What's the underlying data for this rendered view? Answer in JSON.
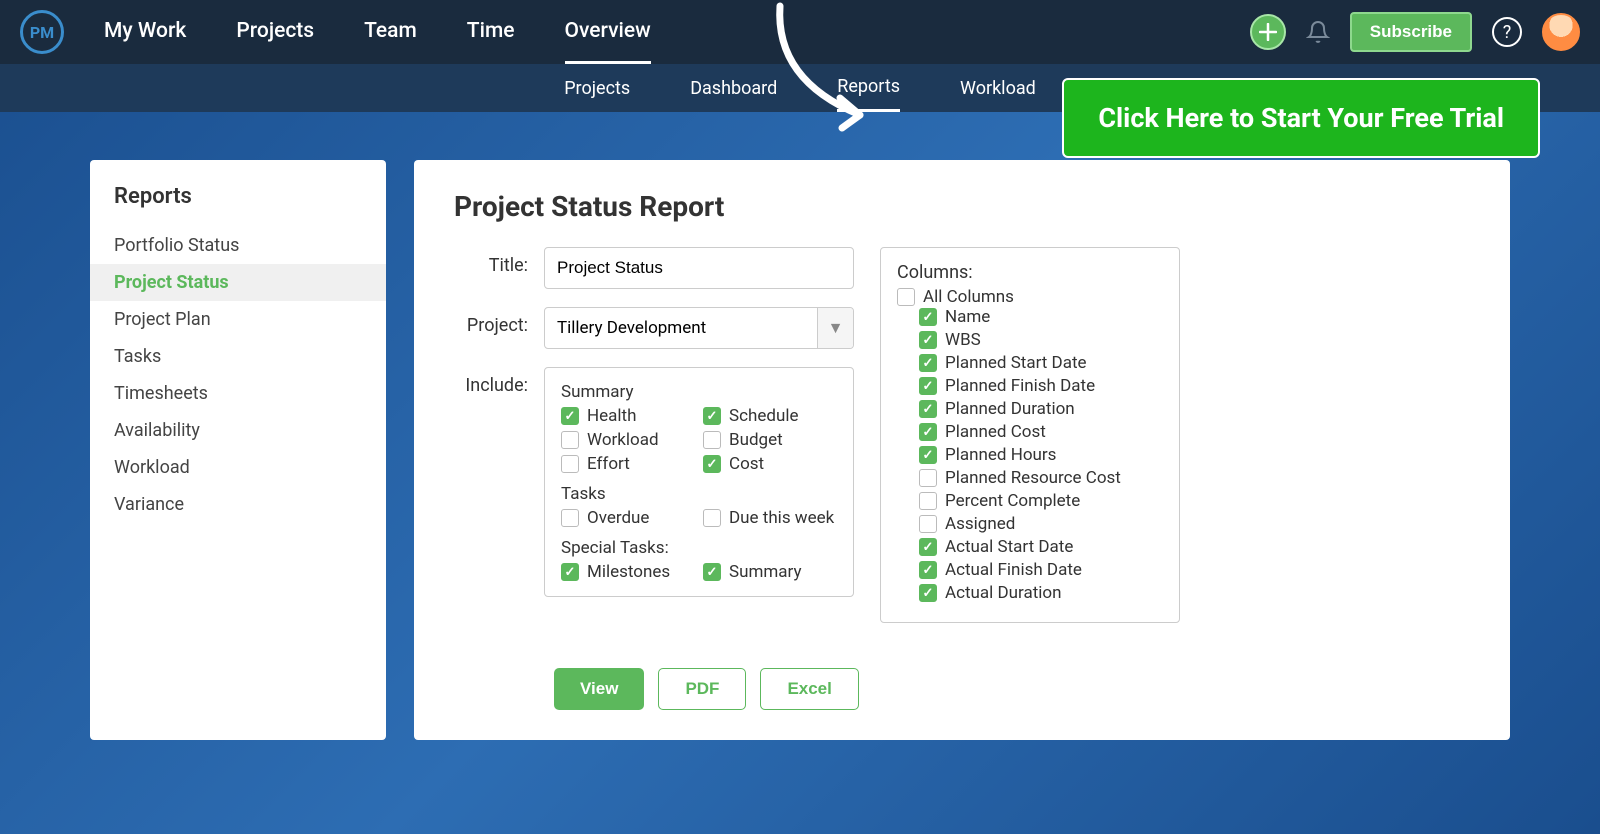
{
  "logo": "PM",
  "nav": [
    "My Work",
    "Projects",
    "Team",
    "Time",
    "Overview"
  ],
  "nav_active": 4,
  "subscribe_label": "Subscribe",
  "subnav": [
    "Projects",
    "Dashboard",
    "Reports",
    "Workload"
  ],
  "subnav_active": 2,
  "cta_text": "Click Here to Start Your Free Trial",
  "sidebar": {
    "title": "Reports",
    "items": [
      "Portfolio Status",
      "Project Status",
      "Project Plan",
      "Tasks",
      "Timesheets",
      "Availability",
      "Workload",
      "Variance"
    ],
    "active": 1
  },
  "main_title": "Project Status Report",
  "form": {
    "title_label": "Title:",
    "title_value": "Project Status",
    "project_label": "Project:",
    "project_value": "Tillery Development",
    "include_label": "Include:",
    "include": {
      "summary_header": "Summary",
      "summary_items": [
        {
          "label": "Health",
          "checked": true
        },
        {
          "label": "Schedule",
          "checked": true
        },
        {
          "label": "Workload",
          "checked": false
        },
        {
          "label": "Budget",
          "checked": false
        },
        {
          "label": "Effort",
          "checked": false
        },
        {
          "label": "Cost",
          "checked": true
        }
      ],
      "tasks_header": "Tasks",
      "tasks_items": [
        {
          "label": "Overdue",
          "checked": false
        },
        {
          "label": "Due this week",
          "checked": false
        }
      ],
      "special_header": "Special Tasks:",
      "special_items": [
        {
          "label": "Milestones",
          "checked": true
        },
        {
          "label": "Summary",
          "checked": true
        }
      ]
    }
  },
  "columns": {
    "label": "Columns:",
    "all_label": "All Columns",
    "all_checked": false,
    "items": [
      {
        "label": "Name",
        "checked": true
      },
      {
        "label": "WBS",
        "checked": true
      },
      {
        "label": "Planned Start Date",
        "checked": true
      },
      {
        "label": "Planned Finish Date",
        "checked": true
      },
      {
        "label": "Planned Duration",
        "checked": true
      },
      {
        "label": "Planned Cost",
        "checked": true
      },
      {
        "label": "Planned Hours",
        "checked": true
      },
      {
        "label": "Planned Resource Cost",
        "checked": false
      },
      {
        "label": "Percent Complete",
        "checked": false
      },
      {
        "label": "Assigned",
        "checked": false
      },
      {
        "label": "Actual Start Date",
        "checked": true
      },
      {
        "label": "Actual Finish Date",
        "checked": true
      },
      {
        "label": "Actual Duration",
        "checked": true
      }
    ]
  },
  "actions": {
    "view": "View",
    "pdf": "PDF",
    "excel": "Excel"
  }
}
